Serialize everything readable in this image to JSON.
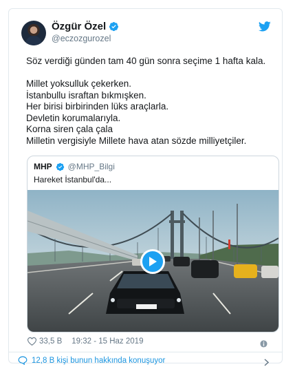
{
  "author": {
    "display_name": "Özgür Özel",
    "handle": "@eczozgurozel"
  },
  "tweet": {
    "text": "Söz verdiği günden tam 40 gün sonra seçime 1 hafta kala.\n\nMillet yoksulluk çekerken.\nİstanbullu israftan bıkmışken.\nHer birisi birbirinden lüks araçlarla.\nDevletin korumalarıyla.\nKorna siren çala çala\nMilletin vergisiyle Millete hava atan sözde milliyetçiler."
  },
  "quoted": {
    "name": "MHP",
    "handle": "@MHP_Bilgi",
    "text": "Hareket İstanbul'da..."
  },
  "meta": {
    "likes": "33,5 B",
    "timestamp": "19:32 - 15 Haz 2019"
  },
  "conversation": {
    "label": "12,8 B kişi bunun hakkında konuşuyor"
  },
  "icons": {
    "verified": "verified-badge-icon",
    "brand": "twitter-bird-icon",
    "like": "heart-icon",
    "info": "info-icon",
    "play": "play-icon",
    "conversation": "comment-icon",
    "chevron": "chevron-right-icon"
  },
  "colors": {
    "accent": "#1da1f2",
    "link": "#1b95e0",
    "muted": "#657786",
    "border": "#e1e8ed"
  }
}
